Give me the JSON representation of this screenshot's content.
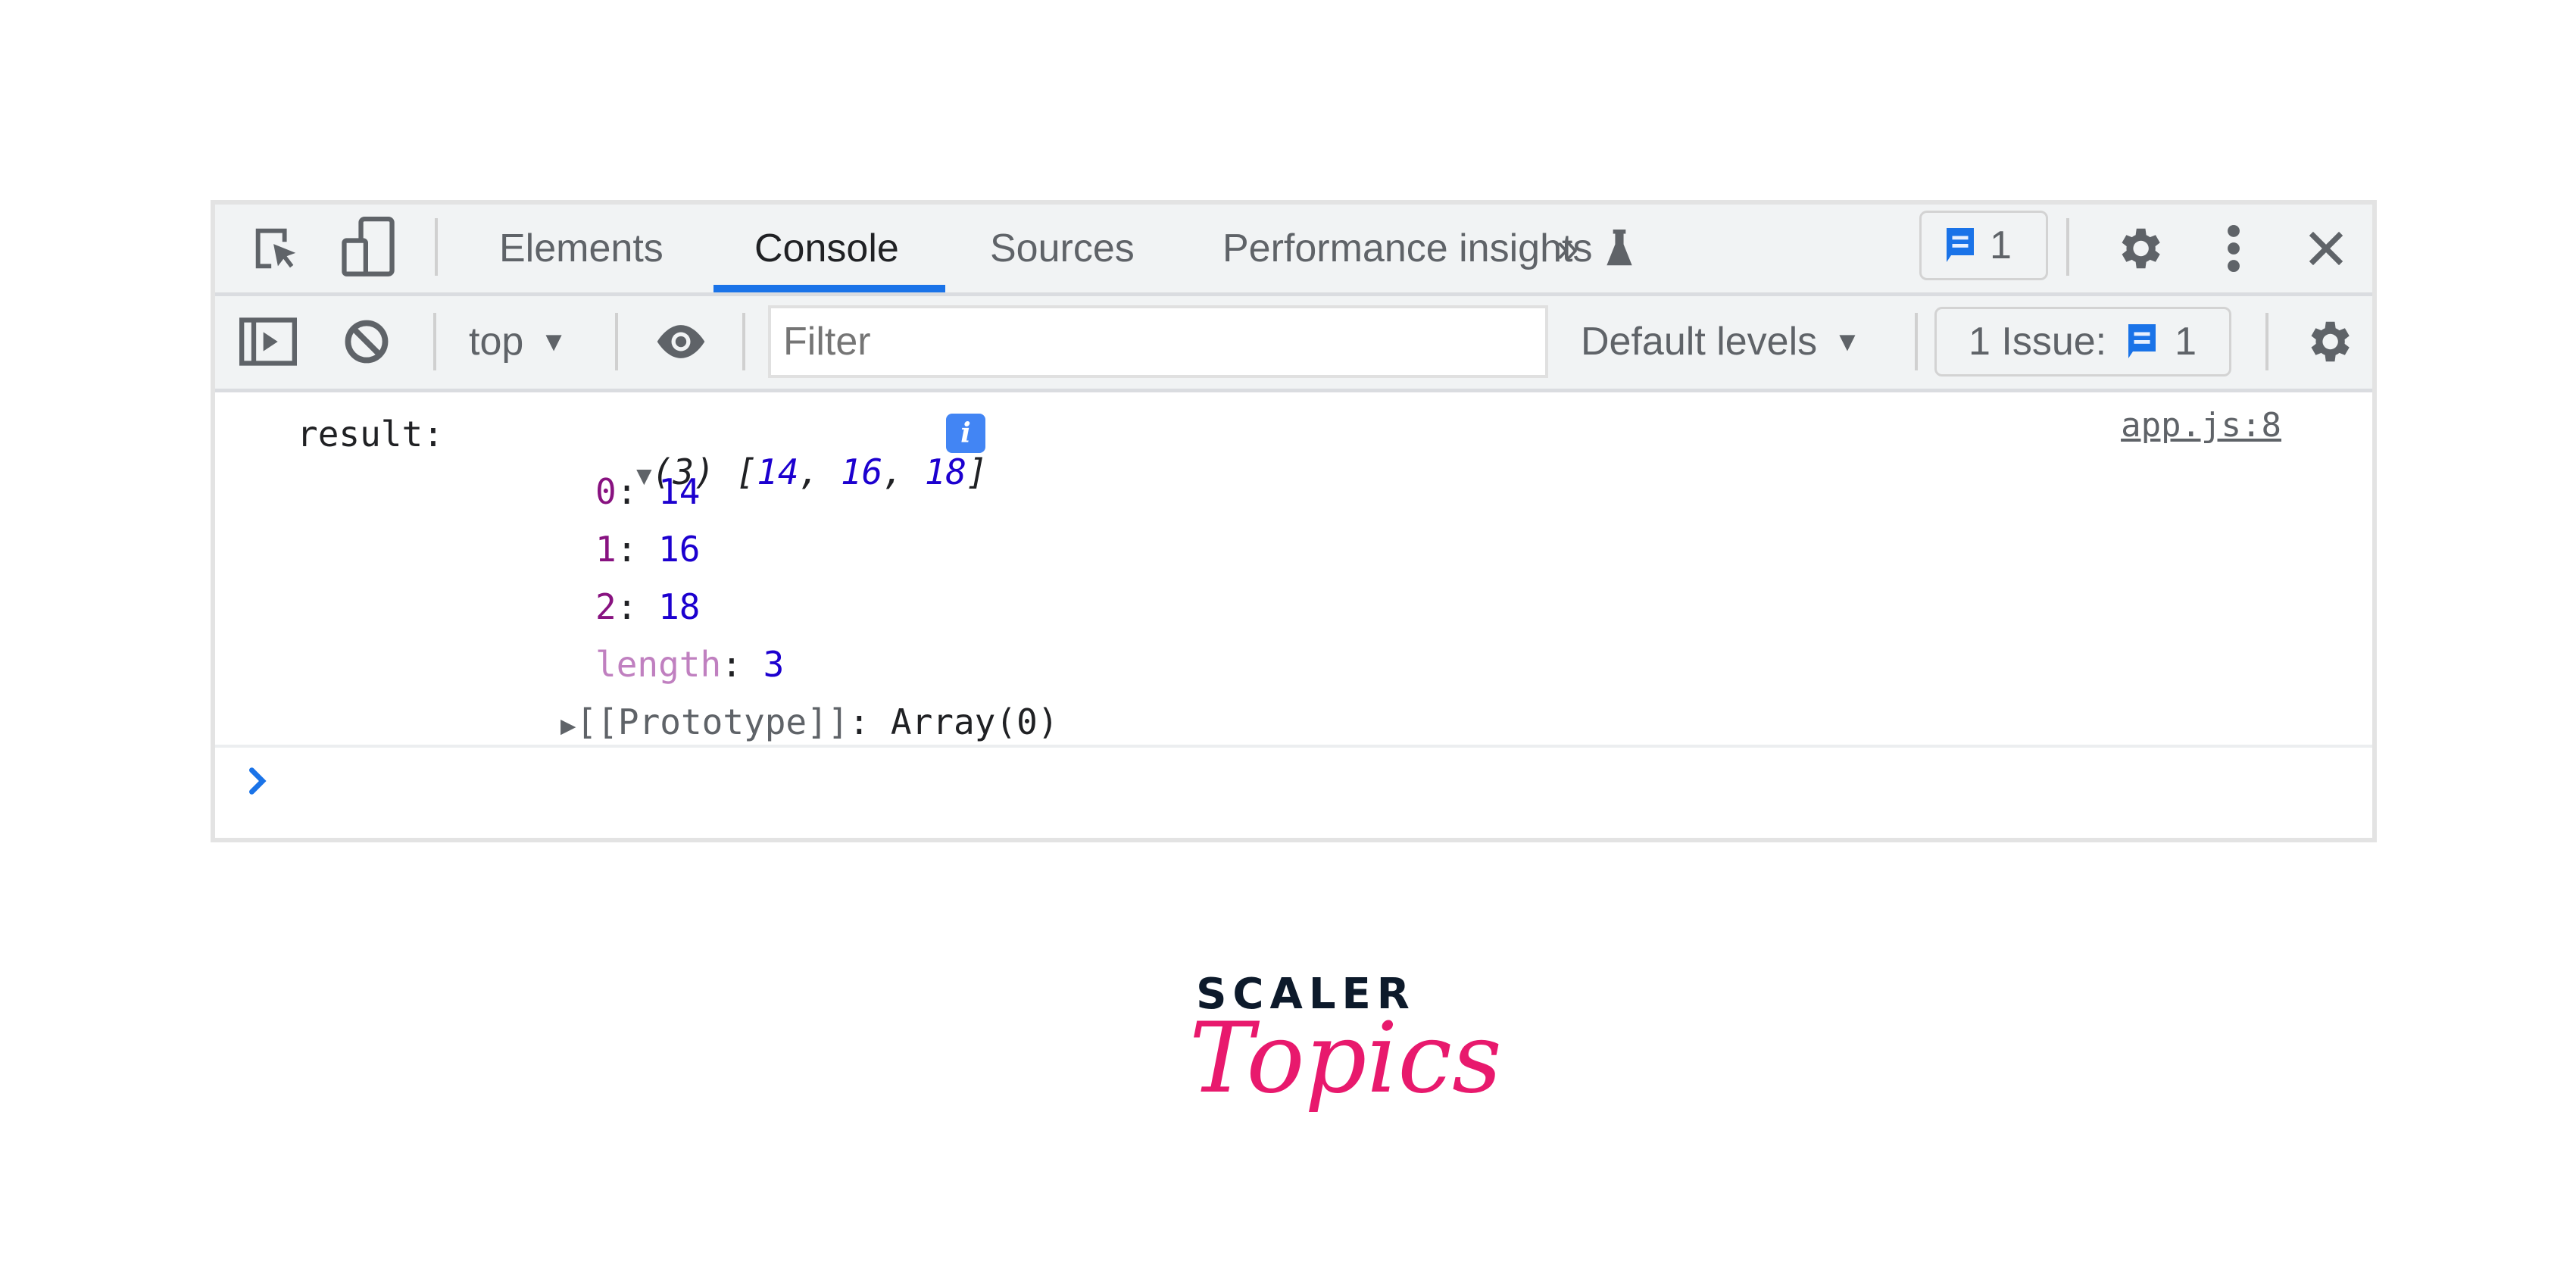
{
  "toolbar": {
    "tabs": [
      {
        "label": "Elements",
        "active": false
      },
      {
        "label": "Console",
        "active": true
      },
      {
        "label": "Sources",
        "active": false
      },
      {
        "label": "Performance insights",
        "active": false
      }
    ],
    "more_tabs_icon": "chevrons-right",
    "messages_badge_count": "1",
    "icons": [
      "inspect-element-icon",
      "device-toolbar-icon",
      "flask-icon",
      "message-icon",
      "gear-icon",
      "kebab-menu-icon",
      "close-icon"
    ]
  },
  "console_toolbar": {
    "context_select": "top",
    "filter_placeholder": "Filter",
    "levels_select": "Default levels",
    "issues_label": "1 Issue:",
    "issues_count": "1",
    "icons": [
      "sidebar-toggle-icon",
      "clear-console-icon",
      "eye-icon",
      "gear-icon"
    ]
  },
  "console": {
    "log_label": "result:",
    "summary_prefix": "(3) ",
    "summary_open": "[",
    "summary_items": [
      "14",
      "16",
      "18"
    ],
    "summary_close": "]",
    "source_link": "app.js:8",
    "entries": [
      {
        "key": "0",
        "value": "14"
      },
      {
        "key": "1",
        "value": "16"
      },
      {
        "key": "2",
        "value": "18"
      }
    ],
    "length_key": "length",
    "length_value": "3",
    "prototype_label": "[[Prototype]]",
    "prototype_value": "Array(0)"
  },
  "colors": {
    "accent": "#1a73e8",
    "key": "#881280",
    "number": "#1c00cf",
    "logo_dark": "#0d1a2b",
    "logo_pink": "#e8196d"
  },
  "logo": {
    "brand": "SCALER",
    "script": "Topics"
  }
}
